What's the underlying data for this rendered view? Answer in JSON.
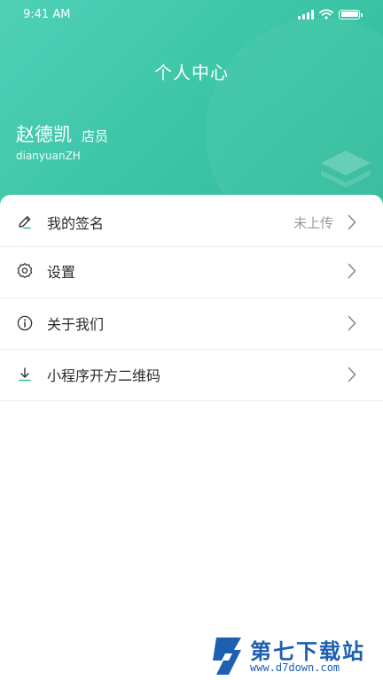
{
  "status_bar": {
    "time": "9:41 AM"
  },
  "header": {
    "title": "个人中心",
    "user_name": "赵德凯",
    "user_role": "店员",
    "user_id": "dianyuanZH"
  },
  "menu": [
    {
      "label": "我的签名",
      "value": "未上传",
      "icon": "pen-icon"
    },
    {
      "label": "设置",
      "icon": "gear-icon"
    },
    {
      "label": "关于我们",
      "icon": "info-icon"
    },
    {
      "label": "小程序开方二维码",
      "icon": "download-icon"
    }
  ],
  "watermark": {
    "title": "第七下载站",
    "url": "www.d7down.com"
  },
  "colors": {
    "accent": "#3cc6a8",
    "text": "#2b2b2b",
    "muted": "#9a9a9a",
    "watermark": "#1d5fb0"
  }
}
